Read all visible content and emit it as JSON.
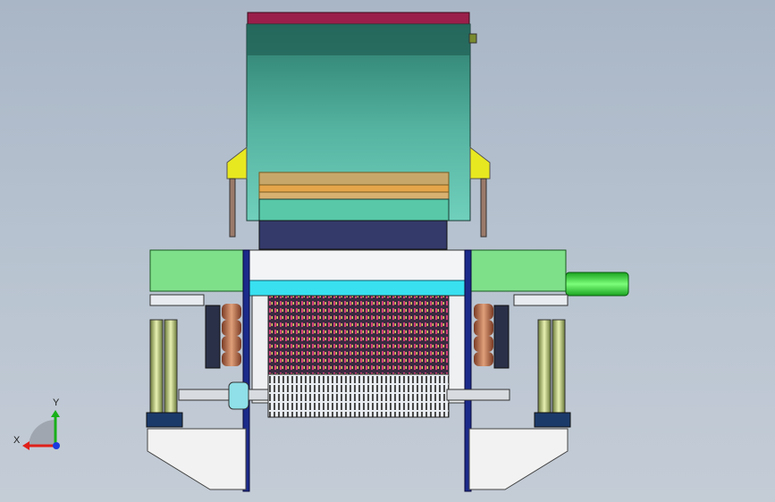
{
  "viewport": {
    "background_top": "#a9b6c6",
    "background_bottom": "#c4ccd6"
  },
  "model": {
    "palette": {
      "hopper_top": "#9a1f4a",
      "hopper_teal": "#5fbfae",
      "platform_green": "#7fe08a",
      "shaft_green": "#3fd94a",
      "rotor_magenta": "#b0306a",
      "frame_blue": "#1b2a8a",
      "cyan_bar": "#38e0f0",
      "base_white": "#f2f2f2",
      "roller_orange": "#c8785a"
    }
  },
  "triad": {
    "x_label": "X",
    "y_label": "Y",
    "x_color": "#e0201a",
    "y_color": "#18b018",
    "z_color": "#1a3ae0"
  }
}
